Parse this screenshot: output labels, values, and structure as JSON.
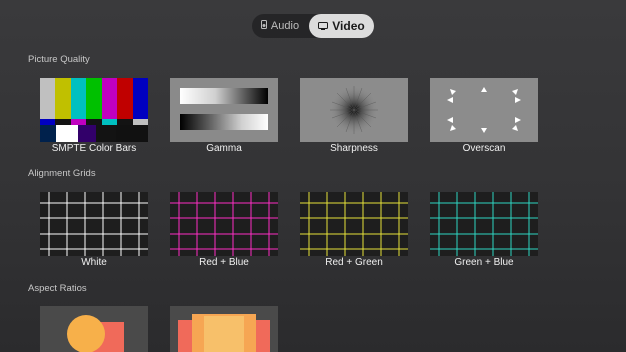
{
  "tabs": {
    "audio": "Audio",
    "video": "Video",
    "audio_icon": "speaker-icon",
    "video_icon": "tv-icon",
    "selected": "Video"
  },
  "sections": {
    "picture_quality": "Picture Quality",
    "alignment_grids": "Alignment Grids",
    "aspect_ratios": "Aspect Ratios"
  },
  "picture_quality": [
    "SMPTE Color Bars",
    "Gamma",
    "Sharpness",
    "Overscan"
  ],
  "alignment_grids": [
    "White",
    "Red + Blue",
    "Red + Green",
    "Green + Blue"
  ],
  "colors": {
    "grid_white": "#ffffff",
    "grid_red_blue": "#ff2fc4",
    "grid_red_green": "#e6e23a",
    "grid_green_blue": "#2fd6c2"
  }
}
